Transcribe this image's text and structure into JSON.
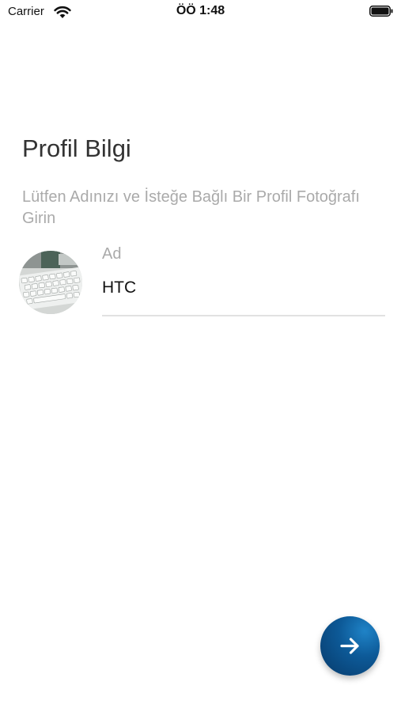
{
  "status_bar": {
    "carrier": "Carrier",
    "time": "ÖÖ 1:48",
    "wifi_icon": "wifi-icon",
    "battery_icon": "battery-icon"
  },
  "profile": {
    "title": "Profil Bilgi",
    "subtitle": "Lütfen Adınızı ve İsteğe Bağlı Bir Profil Fotoğrafı Girin",
    "avatar_icon": "profile-photo",
    "name_label": "Ad",
    "name_value": "HTC"
  },
  "next_button": {
    "icon": "arrow-right-icon",
    "gradient_start": "#1f83c7",
    "gradient_end": "#073a6a"
  }
}
